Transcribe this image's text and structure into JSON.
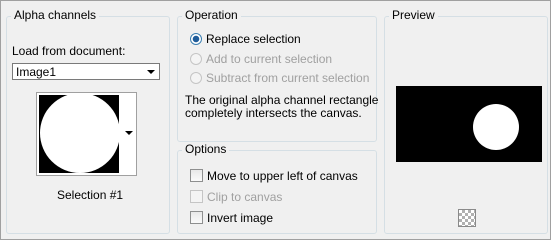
{
  "alpha_channels": {
    "title": "Alpha channels",
    "load_from_label": "Load from document:",
    "document_value": "Image1",
    "selection_caption": "Selection #1"
  },
  "operation": {
    "title": "Operation",
    "options": [
      {
        "label": "Replace selection",
        "checked": true,
        "enabled": true
      },
      {
        "label": "Add to current selection",
        "checked": false,
        "enabled": false
      },
      {
        "label": "Subtract from current selection",
        "checked": false,
        "enabled": false
      }
    ],
    "message": [
      "The original alpha channel rectangle",
      "completely intersects the canvas."
    ]
  },
  "options": {
    "title": "Options",
    "items": [
      {
        "label": "Move to upper left of canvas",
        "checked": false,
        "enabled": true
      },
      {
        "label": "Clip to canvas",
        "checked": false,
        "enabled": false
      },
      {
        "label": "Invert image",
        "checked": false,
        "enabled": true
      }
    ]
  },
  "preview": {
    "title": "Preview",
    "transparency_icon": "checkerboard-icon"
  },
  "colors": {
    "background": "#f0f0f0",
    "group_border": "#d5dfe5",
    "disabled_text": "#a0a0a0"
  }
}
